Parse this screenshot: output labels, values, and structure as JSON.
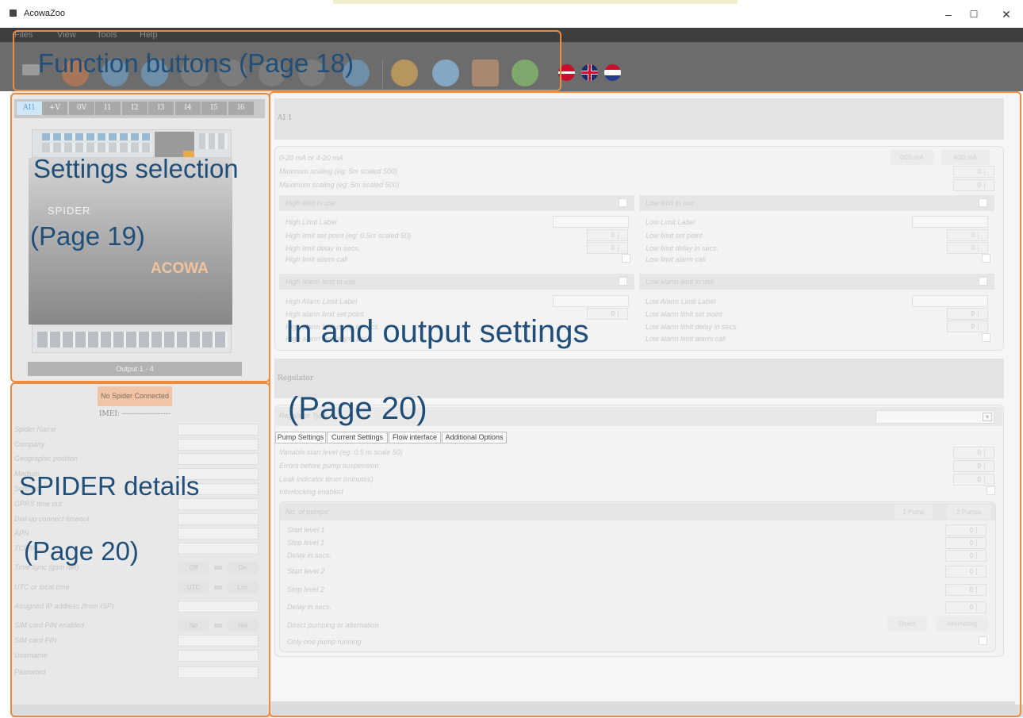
{
  "window": {
    "title": "AcowaZoo",
    "minimize": "–",
    "maximize": "☐",
    "close": "✕"
  },
  "menu": [
    "Files",
    "View",
    "Tools",
    "Help"
  ],
  "toolbar": {
    "buttons": [
      "save-icon",
      "settings-gear-icon",
      "waveform-icon",
      "chart-icon",
      "sync-icon"
    ],
    "languages": [
      "danish-flag-icon",
      "uk-flag-icon",
      "dutch-flag-icon"
    ]
  },
  "annotations": {
    "function_buttons": "Function buttons (Page 18)",
    "settings_selection": "Settings selection",
    "settings_page": "(Page 19)",
    "io_settings": "In and output settings",
    "io_page": "(Page 20)",
    "spider_details": "SPIDER details",
    "spider_page": "(Page 20)"
  },
  "channels": [
    "AI1",
    "+V",
    "0V",
    "I1",
    "I2",
    "I3",
    "I4",
    "I5",
    "I6"
  ],
  "device": {
    "model": "SPIDER",
    "brand": "ACOWA",
    "output_label": "Output 1 - 4"
  },
  "spider": {
    "status": "No Spider Connected",
    "imei": "IMEI: --------------------",
    "fields": [
      "Spider Name",
      "Company",
      "Geographic position",
      "Medium",
      "Settings",
      "GPRS time out",
      "Dial-up connect timeout",
      "APN",
      "TCP/IP",
      "Time sync (gsm net)",
      "UTC or local time",
      "Assigned IP address (from ISP)",
      "SIM card PIN enabled",
      "SIM card PIN",
      "Username",
      "Password"
    ],
    "toggles": {
      "time_sync": [
        "Off",
        "On"
      ],
      "utc_local": [
        "UTC",
        "Loc"
      ],
      "sim_pin": [
        "No",
        "Yes"
      ]
    }
  },
  "ai1": {
    "title": "AI 1",
    "range_label": "0-20 mA or 4-20 mA",
    "range_buttons": [
      "0/20 mA",
      "4/20 mA"
    ],
    "min_scaling": "Minimum scaling (eg: 5m scaled 500)",
    "max_scaling": "Maximum scaling (eg: 5m scaled 500)",
    "zero": "0",
    "high_limit": {
      "head": "High limit in use",
      "label": "High Limit Label",
      "setpoint": "High limit set point (eg: 0.5m scaled 50)",
      "delay": "High limit delay in secs.",
      "alarm": "High limit alarm call"
    },
    "low_limit": {
      "head": "Low limit in use",
      "label": "Low Limit Label",
      "setpoint": "Low limit set point",
      "delay": "Low limit delay in secs.",
      "alarm": "Low limit alarm call"
    },
    "high_alarm": {
      "head": "High alarm limit in use",
      "label": "High Alarm Limit Label",
      "setpoint": "High alarm limit set point",
      "delay": "High alarm limit delay in secs.",
      "alarm": "High alarm limit alarm call"
    },
    "low_alarm": {
      "head": "Low alarm limit in use",
      "label": "Low Alarm Limit Label",
      "setpoint": "Low alarm limit set point",
      "delay": "Low alarm limit delay in secs.",
      "alarm": "Low alarm limit alarm call"
    }
  },
  "regulator": {
    "title": "Regulator",
    "type_label": "Regulator Type",
    "tabs": [
      "Pump Settings",
      "Current Settings",
      "Flow interface",
      "Additional Options"
    ],
    "variable_start": "Variable start level (eg: 0.5 m scale 50)",
    "errors": "Errors before pump suspension",
    "leak": "Leak indicator timer (minutes)",
    "interlocking": "Interlocking enabled",
    "pumps_label": "No. of pumps:",
    "pumps_buttons": [
      "1 Pump",
      "2 Pumps"
    ],
    "start1": "Start level 1",
    "stop1": "Stop level 1",
    "delay1": "Delay in secs.",
    "start2": "Start level 2",
    "stop2": "Stop level 2",
    "delay2": "Delay in secs.",
    "direct_alt": "Direct pumping or alternation",
    "direct_buttons": [
      "Direct",
      "Alternating"
    ],
    "one_pump": "Only one pump running"
  }
}
